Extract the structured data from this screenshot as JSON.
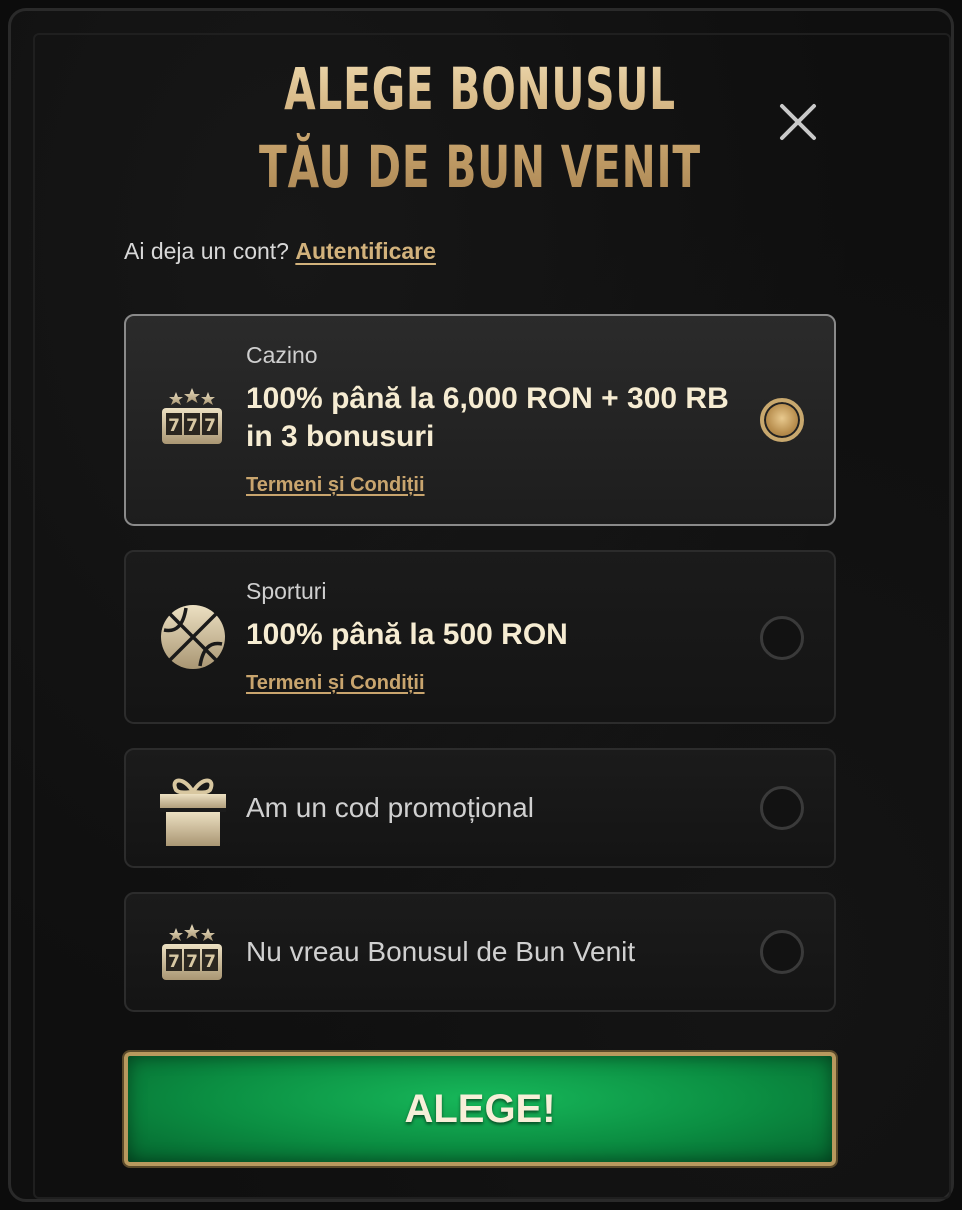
{
  "dialog": {
    "title": "ALEGE BONUSUL TĂU DE BUN VENIT",
    "close_icon": "close-icon"
  },
  "login": {
    "prompt": "Ai deja un cont?",
    "link_label": "Autentificare"
  },
  "options": [
    {
      "id": "cazino",
      "icon": "slot-machine-icon",
      "category": "Cazino",
      "offer": "100% până la 6,000 RON + 300 RB in 3 bonusuri",
      "terms_label": "Termeni și Condiții",
      "selected": true
    },
    {
      "id": "sporturi",
      "icon": "basketball-icon",
      "category": "Sporturi",
      "offer": "100% până la 500 RON",
      "terms_label": "Termeni și Condiții",
      "selected": false
    },
    {
      "id": "promo",
      "icon": "gift-icon",
      "label": "Am un cod promoțional",
      "selected": false
    },
    {
      "id": "none",
      "icon": "slot-machine-icon",
      "label": "Nu vreau Bonusul de Bun Venit",
      "selected": false
    }
  ],
  "submit": {
    "label": "ALEGE!"
  },
  "colors": {
    "gold": "#c9a56e",
    "cta_green": "#0b8e42",
    "background": "#0f0f0f"
  }
}
